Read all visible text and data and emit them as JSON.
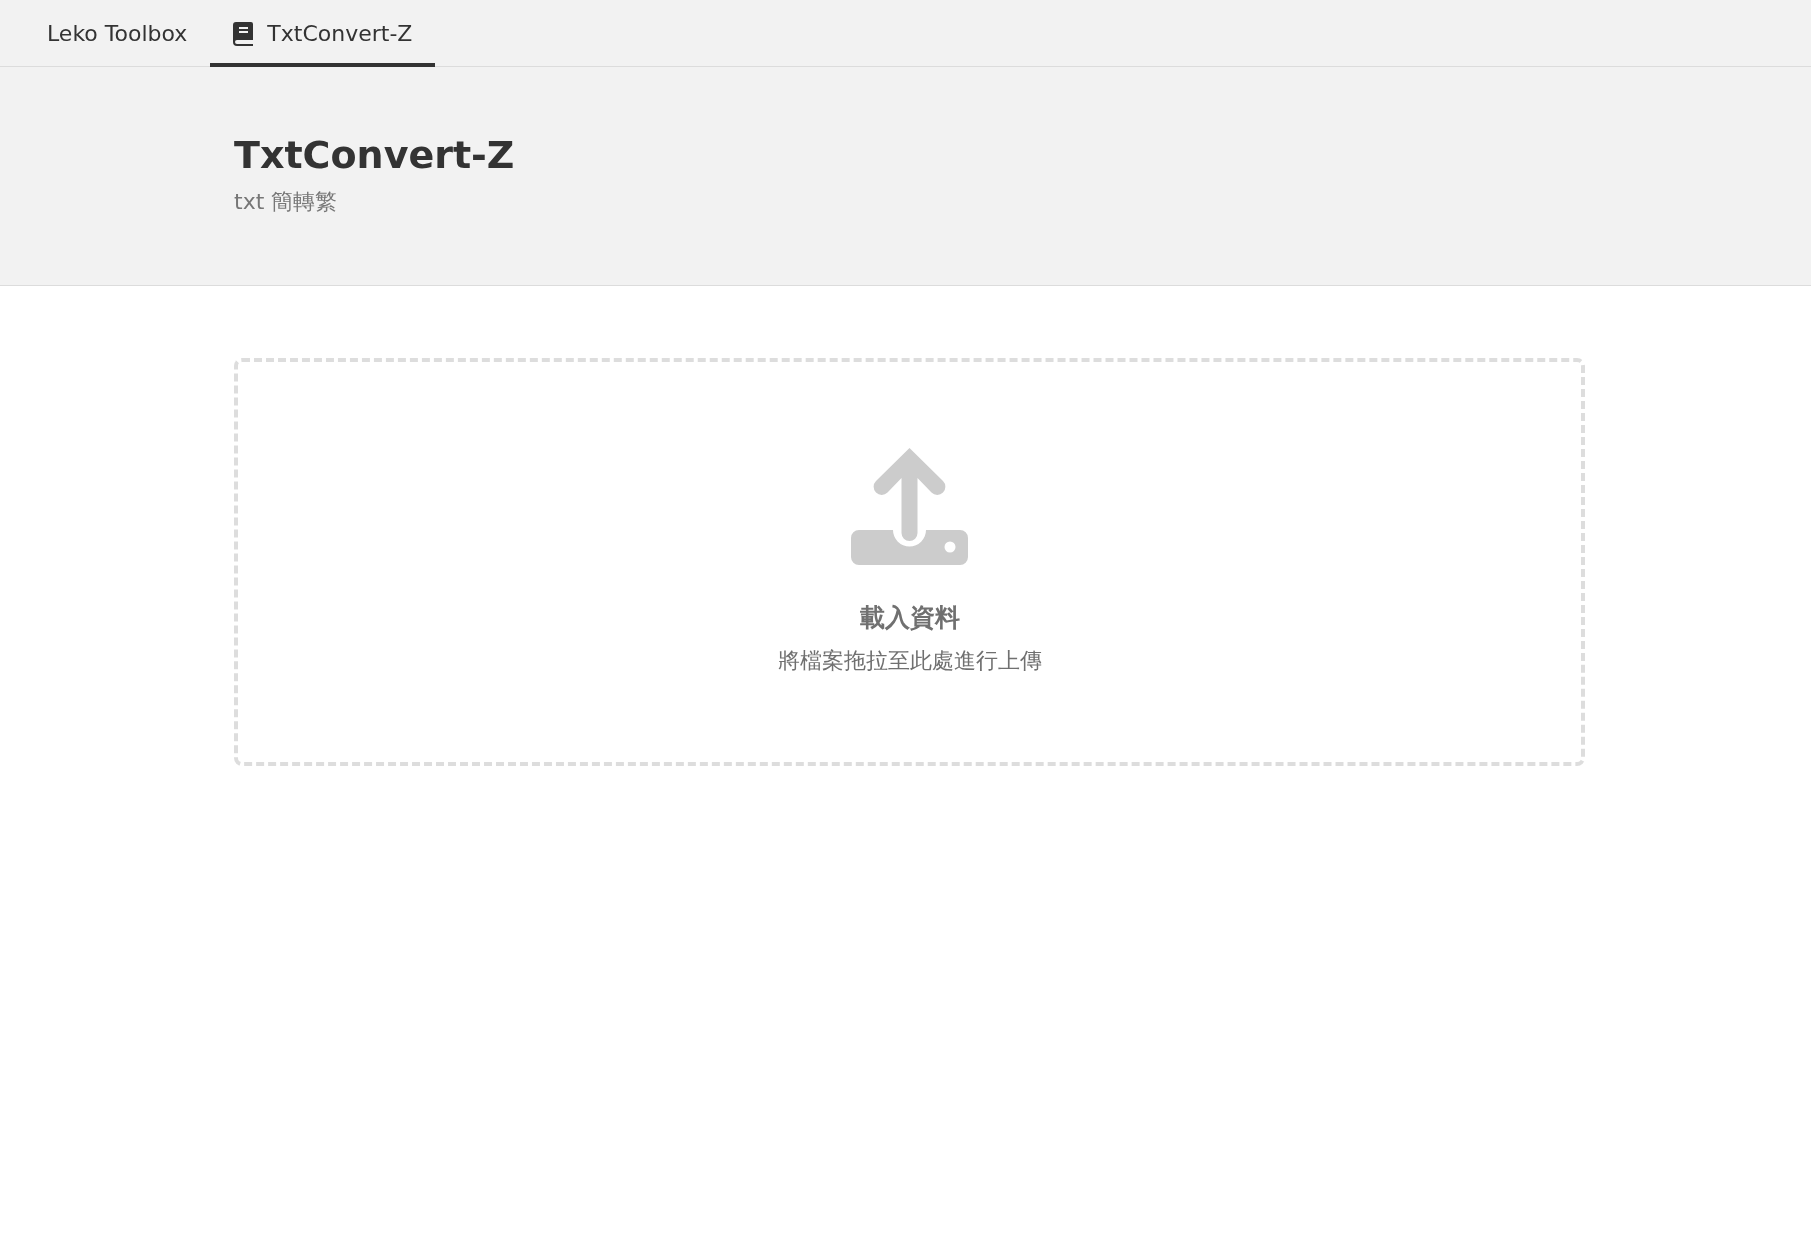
{
  "tabs": [
    {
      "label": "Leko Toolbox",
      "kind": "text",
      "selected": false
    },
    {
      "label": "TxtConvert-Z",
      "kind": "app",
      "selected": true
    }
  ],
  "header": {
    "title": "TxtConvert-Z",
    "subtitle": "txt 簡轉繁"
  },
  "dropzone": {
    "title": "載入資料",
    "hint": "將檔案拖拉至此處進行上傳"
  }
}
